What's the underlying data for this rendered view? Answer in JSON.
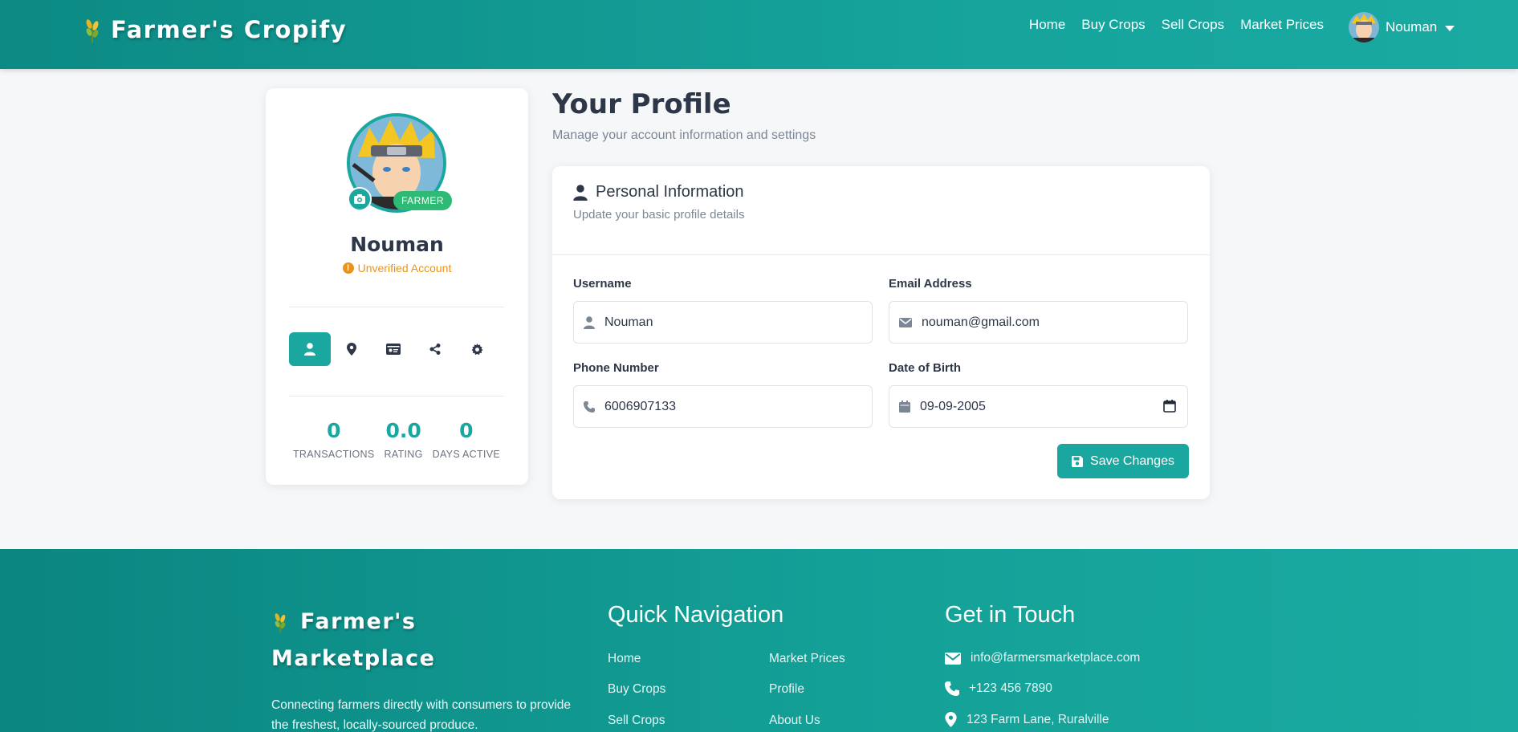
{
  "header": {
    "brand": "Farmer's Cropify",
    "nav": [
      "Home",
      "Buy Crops",
      "Sell Crops",
      "Market Prices"
    ],
    "user_name": "Nouman"
  },
  "profile": {
    "name": "Nouman",
    "role_badge": "FARMER",
    "status": "Unverified Account",
    "tabs": [
      "user-icon",
      "map-pin-icon",
      "id-card-icon",
      "share-icon",
      "gear-icon"
    ],
    "stats": [
      {
        "value": "0",
        "label": "TRANSACTIONS"
      },
      {
        "value": "0.0",
        "label": "RATING"
      },
      {
        "value": "0",
        "label": "DAYS ACTIVE"
      }
    ]
  },
  "main": {
    "title": "Your Profile",
    "subtitle": "Manage your account information and settings",
    "section_title": "Personal Information",
    "section_subtitle": "Update your basic profile details",
    "fields": {
      "username": {
        "label": "Username",
        "value": "Nouman"
      },
      "email": {
        "label": "Email Address",
        "value": "nouman@gmail.com"
      },
      "phone": {
        "label": "Phone Number",
        "value": "6006907133"
      },
      "dob": {
        "label": "Date of Birth",
        "value": "09-09-2005"
      }
    },
    "save_label": "Save Changes"
  },
  "footer": {
    "brand_line1": "Farmer's",
    "brand_line2": "Marketplace",
    "description": "Connecting farmers directly with consumers to provide the freshest, locally-sourced produce.",
    "nav_heading": "Quick Navigation",
    "nav_col1": [
      "Home",
      "Buy Crops",
      "Sell Crops"
    ],
    "nav_col2": [
      "Market Prices",
      "Profile",
      "About Us"
    ],
    "contact_heading": "Get in Touch",
    "contact": {
      "email": "info@farmersmarketplace.com",
      "phone": "+123 456 7890",
      "address": "123 Farm Lane, Ruralville"
    }
  },
  "colors": {
    "primary": "#1aa7a0",
    "warning": "#e8941a",
    "badge": "#2dba74"
  }
}
